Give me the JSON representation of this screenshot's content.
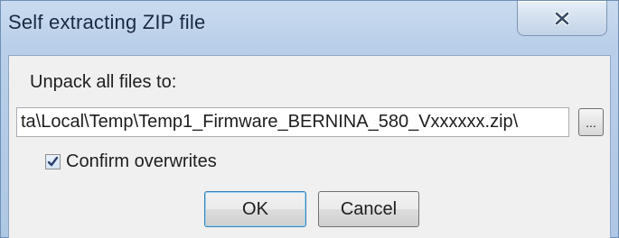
{
  "window": {
    "title": "Self extracting ZIP file",
    "close_icon": "close-x-icon"
  },
  "form": {
    "unpack_label": "Unpack all files to:",
    "path_value": "ta\\Local\\Temp\\Temp1_Firmware_BERNINA_580_Vxxxxxx.zip\\",
    "browse_label": "...",
    "confirm_overwrites_label": "Confirm overwrites",
    "confirm_overwrites_checked": true
  },
  "buttons": {
    "ok_label": "OK",
    "cancel_label": "Cancel"
  },
  "colors": {
    "title_bar": "#b9cfe9",
    "client_bg": "#f0f0f0",
    "ok_focus_border": "#3c7fb1"
  }
}
